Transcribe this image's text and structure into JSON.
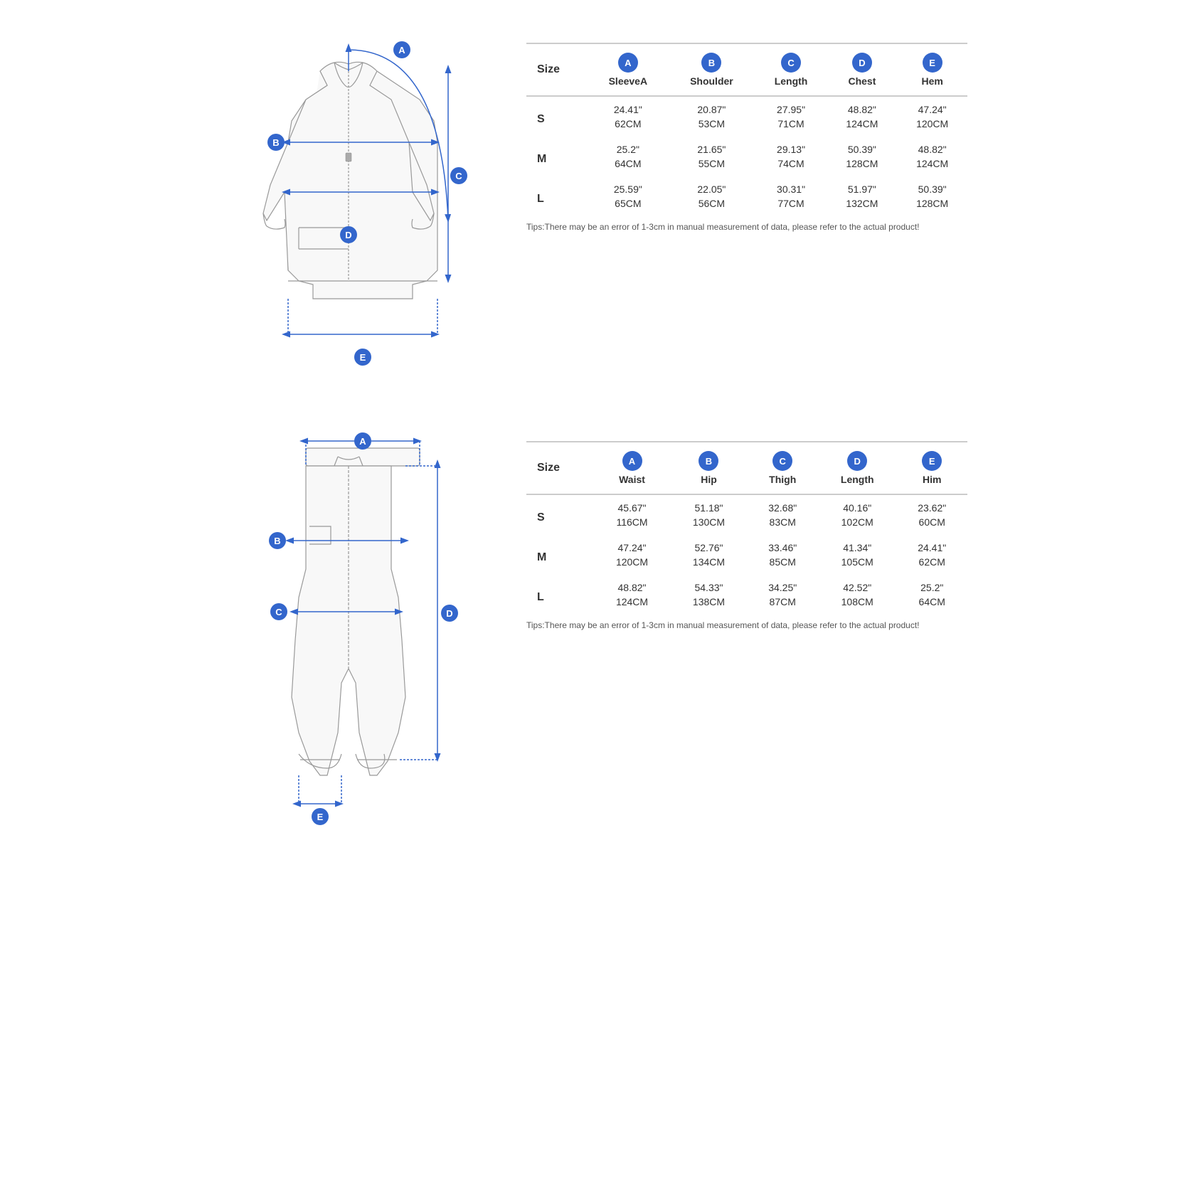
{
  "jacket": {
    "labels": {
      "A": "A",
      "B": "B",
      "C": "C",
      "D": "D",
      "E": "E"
    },
    "table": {
      "columns": [
        {
          "badge": "A",
          "label": "SleeveA"
        },
        {
          "badge": "B",
          "label": "Shoulder"
        },
        {
          "badge": "C",
          "label": "Length"
        },
        {
          "badge": "D",
          "label": "Chest"
        },
        {
          "badge": "E",
          "label": "Hem"
        }
      ],
      "rows": [
        {
          "size": "S",
          "shaded": false,
          "inch": [
            "24.41\"",
            "20.87\"",
            "27.95\"",
            "48.82\"",
            "47.24\""
          ],
          "cm": [
            "62CM",
            "53CM",
            "71CM",
            "124CM",
            "120CM"
          ]
        },
        {
          "size": "M",
          "shaded": true,
          "inch": [
            "25.2\"",
            "21.65\"",
            "29.13\"",
            "50.39\"",
            "48.82\""
          ],
          "cm": [
            "64CM",
            "55CM",
            "74CM",
            "128CM",
            "124CM"
          ]
        },
        {
          "size": "L",
          "shaded": false,
          "inch": [
            "25.59\"",
            "22.05\"",
            "30.31\"",
            "51.97\"",
            "50.39\""
          ],
          "cm": [
            "65CM",
            "56CM",
            "77CM",
            "132CM",
            "128CM"
          ]
        }
      ],
      "tips": "Tips:There may be an error of 1-3cm in manual measurement of data, please refer to the actual product!"
    }
  },
  "pants": {
    "table": {
      "columns": [
        {
          "badge": "A",
          "label": "Waist"
        },
        {
          "badge": "B",
          "label": "Hip"
        },
        {
          "badge": "C",
          "label": "Thigh"
        },
        {
          "badge": "D",
          "label": "Length"
        },
        {
          "badge": "E",
          "label": "Him"
        }
      ],
      "rows": [
        {
          "size": "S",
          "shaded": false,
          "inch": [
            "45.67\"",
            "51.18\"",
            "32.68\"",
            "40.16\"",
            "23.62\""
          ],
          "cm": [
            "116CM",
            "130CM",
            "83CM",
            "102CM",
            "60CM"
          ]
        },
        {
          "size": "M",
          "shaded": true,
          "inch": [
            "47.24\"",
            "52.76\"",
            "33.46\"",
            "41.34\"",
            "24.41\""
          ],
          "cm": [
            "120CM",
            "134CM",
            "85CM",
            "105CM",
            "62CM"
          ]
        },
        {
          "size": "L",
          "shaded": false,
          "inch": [
            "48.82\"",
            "54.33\"",
            "34.25\"",
            "42.52\"",
            "25.2\""
          ],
          "cm": [
            "124CM",
            "138CM",
            "87CM",
            "108CM",
            "64CM"
          ]
        }
      ],
      "tips": "Tips:There may be an error of 1-3cm in manual measurement of data, please refer to the actual product!"
    }
  }
}
